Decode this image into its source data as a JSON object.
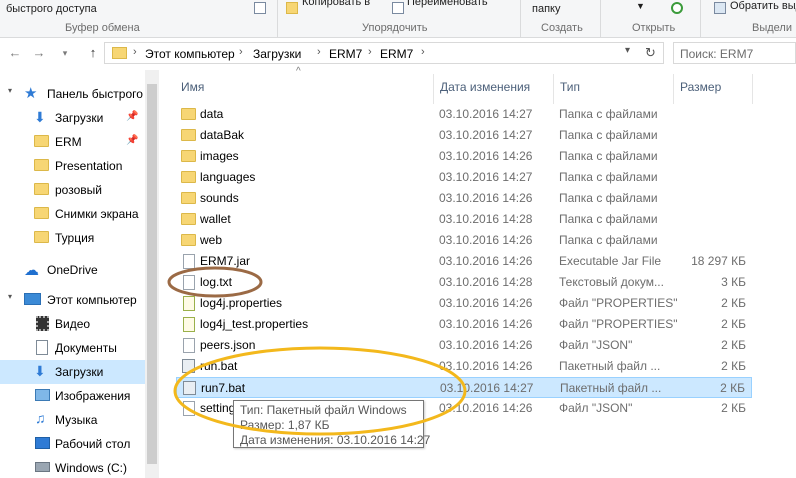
{
  "ribbon": {
    "quick_access_text": "быстрого доступа",
    "clipboard_group": "Буфер обмена",
    "copy_to": "Копировать в",
    "rename": "Переименовать",
    "organize_group": "Упорядочить",
    "folder_text": "папку",
    "create_group": "Создать",
    "open_group": "Открыть",
    "invert_selection": "Обратить выд",
    "select_group": "Выдели"
  },
  "address": {
    "crumbs": [
      "Этот компьютер",
      "Загрузки",
      "ERM7",
      "ERM7"
    ],
    "search_placeholder": "Поиск: ERM7"
  },
  "sidebar": {
    "items": [
      {
        "label": "Панель быстрого",
        "icon": "star-icon"
      },
      {
        "label": "Загрузки",
        "icon": "download-icon",
        "pin": "📌"
      },
      {
        "label": "ERM",
        "icon": "folder-icon",
        "pin": "📌"
      },
      {
        "label": "Presentation",
        "icon": "folder-icon"
      },
      {
        "label": "розовый",
        "icon": "folder-icon"
      },
      {
        "label": "Снимки экрана",
        "icon": "folder-icon"
      },
      {
        "label": "Турция",
        "icon": "folder-icon"
      },
      {
        "label": "OneDrive",
        "icon": "cloud-icon"
      },
      {
        "label": "Этот компьютер",
        "icon": "computer-icon"
      },
      {
        "label": "Видео",
        "icon": "video-icon"
      },
      {
        "label": "Документы",
        "icon": "documents-icon"
      },
      {
        "label": "Загрузки",
        "icon": "download-icon"
      },
      {
        "label": "Изображения",
        "icon": "pictures-icon"
      },
      {
        "label": "Музыка",
        "icon": "music-icon"
      },
      {
        "label": "Рабочий стол",
        "icon": "desktop-icon"
      },
      {
        "label": "Windows (C:)",
        "icon": "drive-icon"
      }
    ]
  },
  "columns": {
    "name": "Имя",
    "date": "Дата изменения",
    "type": "Тип",
    "size": "Размер"
  },
  "files": [
    {
      "name": "data",
      "date": "03.10.2016 14:27",
      "type": "Папка с файлами",
      "size": "",
      "kind": "folder"
    },
    {
      "name": "dataBak",
      "date": "03.10.2016 14:27",
      "type": "Папка с файлами",
      "size": "",
      "kind": "folder"
    },
    {
      "name": "images",
      "date": "03.10.2016 14:26",
      "type": "Папка с файлами",
      "size": "",
      "kind": "folder"
    },
    {
      "name": "languages",
      "date": "03.10.2016 14:27",
      "type": "Папка с файлами",
      "size": "",
      "kind": "folder"
    },
    {
      "name": "sounds",
      "date": "03.10.2016 14:26",
      "type": "Папка с файлами",
      "size": "",
      "kind": "folder"
    },
    {
      "name": "wallet",
      "date": "03.10.2016 14:28",
      "type": "Папка с файлами",
      "size": "",
      "kind": "folder"
    },
    {
      "name": "web",
      "date": "03.10.2016 14:26",
      "type": "Папка с файлами",
      "size": "",
      "kind": "folder"
    },
    {
      "name": "ERM7.jar",
      "date": "03.10.2016 14:26",
      "type": "Executable Jar File",
      "size": "18 297 КБ",
      "kind": "jar"
    },
    {
      "name": "log.txt",
      "date": "03.10.2016 14:28",
      "type": "Текстовый докум...",
      "size": "3 КБ",
      "kind": "txt"
    },
    {
      "name": "log4j.properties",
      "date": "03.10.2016 14:26",
      "type": "Файл \"PROPERTIES\"",
      "size": "2 КБ",
      "kind": "prop"
    },
    {
      "name": "log4j_test.properties",
      "date": "03.10.2016 14:26",
      "type": "Файл \"PROPERTIES\"",
      "size": "2 КБ",
      "kind": "prop"
    },
    {
      "name": "peers.json",
      "date": "03.10.2016 14:26",
      "type": "Файл \"JSON\"",
      "size": "2 КБ",
      "kind": "txt"
    },
    {
      "name": "run.bat",
      "date": "03.10.2016 14:26",
      "type": "Пакетный файл ...",
      "size": "2 КБ",
      "kind": "bat"
    },
    {
      "name": "run7.bat",
      "date": "03.10.2016 14:27",
      "type": "Пакетный файл ...",
      "size": "2 КБ",
      "kind": "bat",
      "selected": true
    },
    {
      "name": "settings.json",
      "date": "03.10.2016 14:26",
      "type": "Файл \"JSON\"",
      "size": "2 КБ",
      "kind": "txt"
    }
  ],
  "tooltip": {
    "type_line": "Тип: Пакетный файл Windows",
    "size_line": "Размер: 1,87 КБ",
    "date_line": "Дата изменения: 03.10.2016 14:27"
  },
  "annotations": {
    "brown": "#9b6a45",
    "yellow": "#f3b81c"
  }
}
